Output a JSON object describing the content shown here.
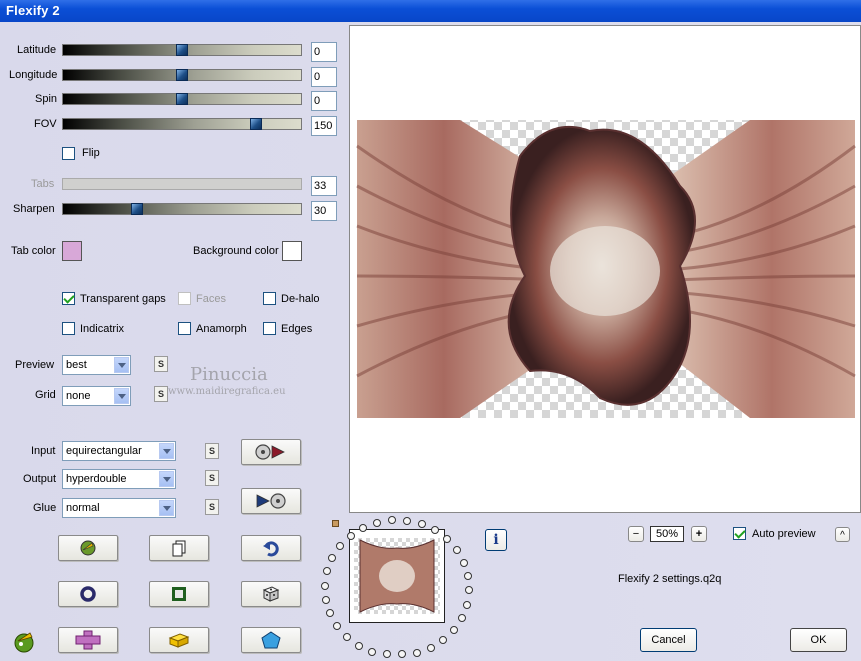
{
  "window": {
    "title": "Flexify 2"
  },
  "controls": {
    "latitude": {
      "label": "Latitude",
      "value": "0",
      "level_percent": 50
    },
    "longitude": {
      "label": "Longitude",
      "value": "0",
      "level_percent": 50
    },
    "spin": {
      "label": "Spin",
      "value": "0",
      "level_percent": 50
    },
    "fov": {
      "label": "FOV",
      "value": "150",
      "level_percent": 81
    },
    "flip": {
      "label": "Flip",
      "checked": false
    },
    "tabs": {
      "label": "Tabs",
      "value": "33",
      "enabled": false
    },
    "sharpen": {
      "label": "Sharpen",
      "value": "30",
      "level_percent": 31
    }
  },
  "colors": {
    "tab_color_label": "Tab color",
    "tab_color": "#d8a8d8",
    "background_color_label": "Background color",
    "background_color": "#ffffff"
  },
  "options": {
    "transparent_gaps": {
      "label": "Transparent gaps",
      "checked": true
    },
    "faces": {
      "label": "Faces",
      "checked": false,
      "enabled": false
    },
    "de_halo": {
      "label": "De-halo",
      "checked": false
    },
    "indicatrix": {
      "label": "Indicatrix",
      "checked": false
    },
    "anamorph": {
      "label": "Anamorph",
      "checked": false
    },
    "edges": {
      "label": "Edges",
      "checked": false
    }
  },
  "view": {
    "preview_label": "Preview",
    "preview_value": "best",
    "grid_label": "Grid",
    "grid_value": "none"
  },
  "projection": {
    "input_label": "Input",
    "input_value": "equirectangular",
    "output_label": "Output",
    "output_value": "hyperdouble",
    "glue_label": "Glue",
    "glue_value": "normal",
    "s_label": "S"
  },
  "watermark": {
    "name": "Pinuccia",
    "site": "www.maidiregrafica.eu"
  },
  "zoom": {
    "minus": "−",
    "value": "50%",
    "plus": "+"
  },
  "auto_preview": {
    "label": "Auto preview",
    "checked": true,
    "up": "^"
  },
  "settings_file": "Flexify 2 settings.q2q",
  "info_label": "i",
  "buttons": {
    "cancel": "Cancel",
    "ok": "OK"
  },
  "accent_colors": {
    "titlebar": "#0b4fd6",
    "slider_thumb": "#1e4f88"
  }
}
